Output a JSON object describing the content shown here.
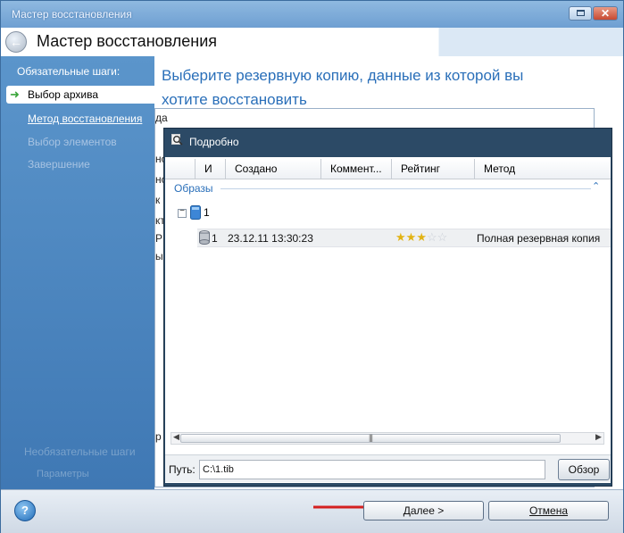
{
  "window": {
    "title": "Мастер восстановления"
  },
  "header": {
    "title": "Мастер восстановления"
  },
  "sidebar": {
    "section": "Обязательные шаги:",
    "items": [
      {
        "label": "Выбор архива",
        "state": "active"
      },
      {
        "label": "Метод восстановления",
        "state": "link"
      },
      {
        "label": "Выбор элементов",
        "state": "disabled"
      },
      {
        "label": "Завершение",
        "state": "disabled"
      }
    ],
    "optional_section": "Необязательные шаги",
    "optional_item": "Параметры"
  },
  "content": {
    "headline": "Выберите резервную копию, данные из которой вы хотите восстановить"
  },
  "background_fragments": [
    "да",
    "но",
    "нс",
    "к (",
    "кт",
    "Р",
    "ы:",
    "р"
  ],
  "details": {
    "title": "Подробно",
    "columns": [
      "И",
      "Создано",
      "Коммент...",
      "Рейтинг",
      "Метод"
    ],
    "group_label": "Образы",
    "node_label": "1",
    "rows": [
      {
        "index": "1",
        "created": "23.12.11 13:30:23",
        "rating": 3,
        "rating_max": 5,
        "method": "Полная резервная копия"
      }
    ],
    "path_label": "Путь:",
    "path_value": "C:\\1.tib",
    "browse_label": "Обзор"
  },
  "footer": {
    "next_label": "Далее >",
    "cancel_label": "Отмена"
  },
  "colors": {
    "sidebar": "#4a86c0",
    "headline": "#2a6fb9",
    "detail_bar": "#2c4a66",
    "arrow": "#d42020",
    "star": "#e2b314"
  }
}
